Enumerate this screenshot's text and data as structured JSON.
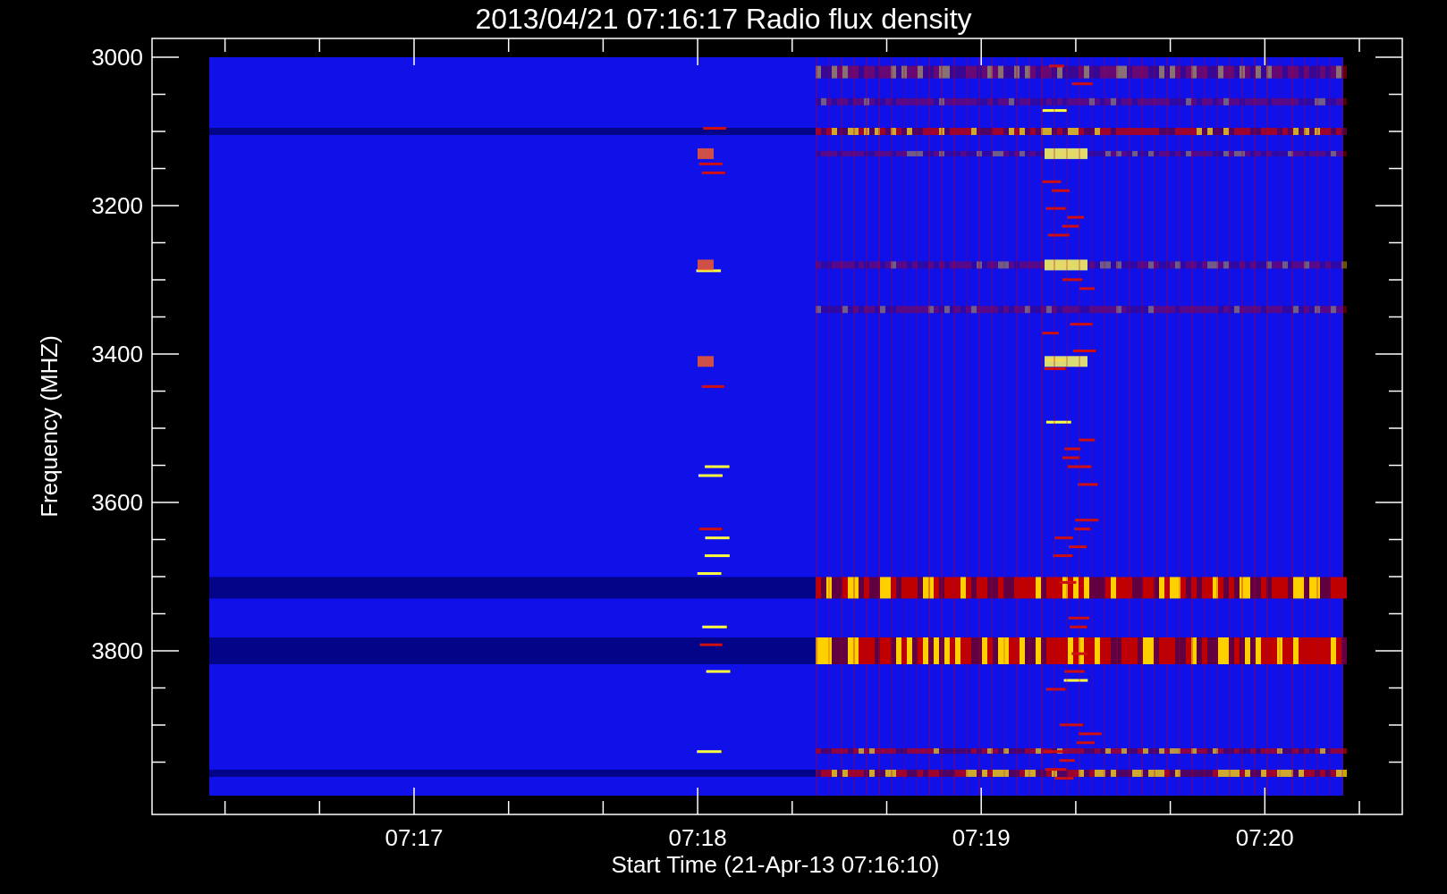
{
  "title": "2013/04/21 07:16:17 Radio flux density",
  "y_axis": {
    "label": "Frequency (MHZ)",
    "tick_labels": [
      "3000",
      "3200",
      "3400",
      "3600",
      "3800"
    ]
  },
  "x_axis": {
    "label": "Start Time (21-Apr-13 07:16:10)",
    "tick_labels": [
      "07:17",
      "07:18",
      "07:19",
      "07:20"
    ]
  }
}
